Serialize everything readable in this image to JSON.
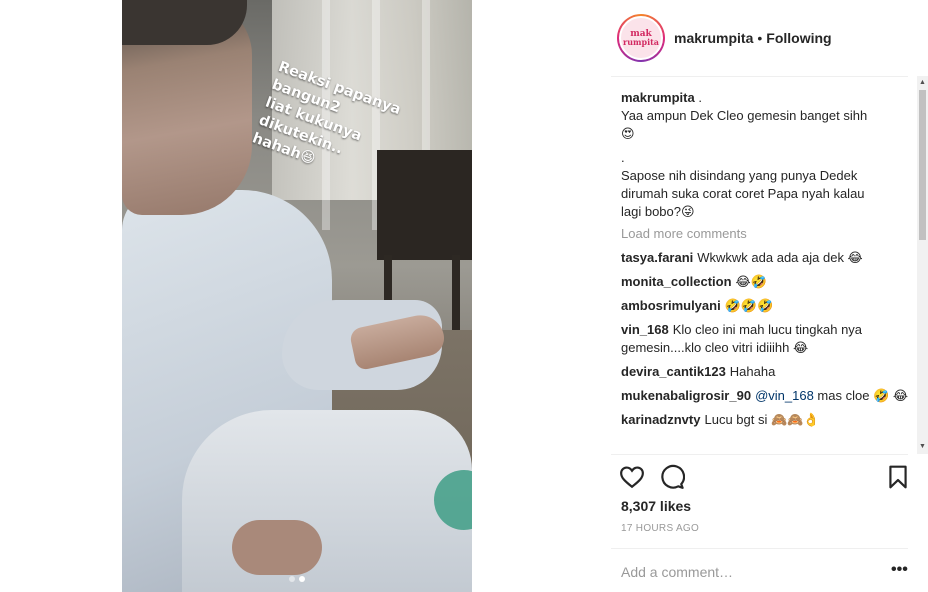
{
  "media": {
    "overlay_text": "Reaksi papanya bangun2\nliat kukunya dikutekin..\nhahah😆",
    "carousel_total": 2,
    "carousel_active": 2
  },
  "header": {
    "username": "makrumpita",
    "separator": "•",
    "follow_label": "Following",
    "avatar_text_1": "mak",
    "avatar_text_2": "rumpita"
  },
  "caption": {
    "username": "makrumpita",
    "lines": [
      ".",
      "Yaa ampun Dek Cleo gemesin banget sihh",
      "😍",
      ".",
      "Sapose nih disindang yang punya Dedek",
      "dirumah suka corat coret Papa nyah kalau",
      "lagi bobo?😜"
    ]
  },
  "comments": {
    "load_more": "Load more comments",
    "items": [
      {
        "user": "tasya.farani",
        "text": "Wkwkwk ada ada aja dek 😂"
      },
      {
        "user": "monita_collection",
        "text": "😂🤣"
      },
      {
        "user": "ambosrimulyani",
        "text": "🤣🤣🤣"
      },
      {
        "user": "vin_168",
        "text": "Klo cleo ini mah lucu tingkah nya gemesin....klo cleo vitri idiiihh 😂"
      },
      {
        "user": "devira_cantik123",
        "text": "Hahaha"
      },
      {
        "user": "mukenabaligrosir_90",
        "mention": "@vin_168",
        "text": " mas cloe 🤣 😂"
      },
      {
        "user": "karinadznvty",
        "text": "Lucu bgt si 🙈🙈👌"
      }
    ]
  },
  "actions": {
    "like_icon": "heart-icon",
    "comment_icon": "speech-bubble-icon",
    "save_icon": "bookmark-icon"
  },
  "likes_text": "8,307 likes",
  "timestamp": "17 HOURS AGO",
  "add_comment": {
    "placeholder": "Add a comment…"
  },
  "more_label": "•••"
}
